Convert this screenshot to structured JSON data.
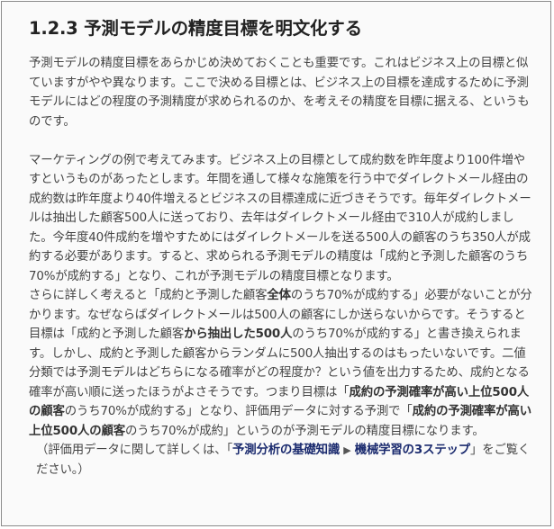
{
  "heading": "1.2.3 予測モデルの精度目標を明文化する",
  "p1": "予測モデルの精度目標をあらかじめ決めておくことも重要です。これはビジネス上の目標と似ていますがやや異なります。ここで決める目標とは、ビジネス上の目標を達成するために予測モデルにはどの程度の予測精度が求められるのか、を考えその精度を目標に据える、というものです。",
  "p2": "マーケティングの例で考えてみます。ビジネス上の目標として成約数を昨年度より100件増やすというものがあったとします。年間を通して様々な施策を行う中でダイレクトメール経由の成約数は昨年度より40件増えるとビジネスの目標達成に近づきそうです。毎年ダイレクトメールは抽出した顧客500人に送っており、去年はダイレクトメール経由で310人が成約しました。今年度40件成約を増やすためにはダイレクトメールを送る500人の顧客のうち350人が成約する必要があります。すると、求められる予測モデルの精度は「成約と予測した顧客のうち70%が成約する」となり、これが予測モデルの精度目標となります。",
  "p3": {
    "t1": "さらに詳しく考えると「成約と予測した顧客",
    "b1": "全体",
    "t2": "のうち70%が成約する」必要がないことが分かります。なぜならばダイレクトメールは500人の顧客にしか送らないからです。そうすると目標は「成約と予測した顧客",
    "b2": "から抽出した500人",
    "t3": "のうち70%が成約する」と書き換えられます。しかし、成約と予測した顧客からランダムに500人抽出するのはもったいないです。二値分類では予測モデルはどちらになる確率がどの程度か？という値を出力するため、成約となる確率が高い順に送ったほうがよさそうです。つまり目標は「",
    "b3": "成約の予測確率が高い上位500人の顧客",
    "t4": "のうち70%が成約する」となり、評価用データに対する予測で「",
    "b4": "成約の予測確率が高い上位500人の顧客",
    "t5": "のうち70%が成約」というのが予測モデルの精度目標になります。"
  },
  "note": {
    "prefix": "（評価用データに関して詳しくは、「",
    "link1": "予測分析の基礎知識",
    "arrow": "▶",
    "link2": "機械学習の3ステップ",
    "suffix": "」をご覧ください。）"
  }
}
